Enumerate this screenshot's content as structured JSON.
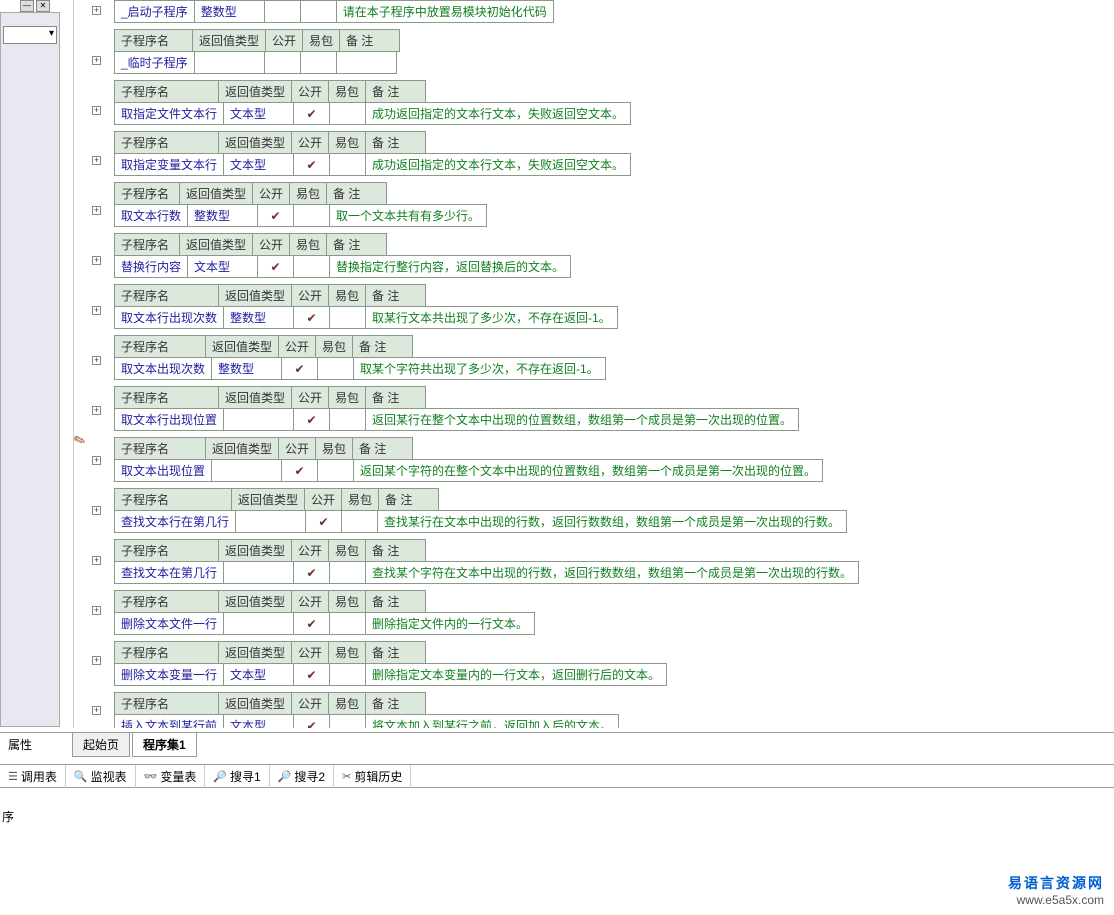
{
  "headers": {
    "name": "子程序名",
    "ret": "返回值类型",
    "pub": "公开",
    "pkg": "易包",
    "note": "备 注"
  },
  "subs": [
    {
      "name": "_启动子程序",
      "ret": "整数型",
      "pub": false,
      "pkg": "",
      "note": "请在本子程序中放置易模块初始化代码",
      "plusTop": 6,
      "headerOnly": false,
      "showHeader": false
    },
    {
      "name": "_临时子程序",
      "ret": "",
      "pub": false,
      "pkg": "",
      "note": "",
      "plusTop": 56,
      "showHeader": true
    },
    {
      "name": "取指定文件文本行",
      "ret": "文本型",
      "pub": true,
      "pkg": "",
      "note": "成功返回指定的文本行文本，失败返回空文本。",
      "plusTop": 106,
      "showHeader": true
    },
    {
      "name": "取指定变量文本行",
      "ret": "文本型",
      "pub": true,
      "pkg": "",
      "note": "成功返回指定的文本行文本，失败返回空文本。",
      "plusTop": 156,
      "showHeader": true
    },
    {
      "name": "取文本行数",
      "ret": "整数型",
      "pub": true,
      "pkg": "",
      "note": "取一个文本共有有多少行。",
      "plusTop": 206,
      "showHeader": true
    },
    {
      "name": "替换行内容",
      "ret": "文本型",
      "pub": true,
      "pkg": "",
      "note": "替换指定行整行内容，返回替换后的文本。",
      "plusTop": 256,
      "showHeader": true
    },
    {
      "name": "取文本行出现次数",
      "ret": "整数型",
      "pub": true,
      "pkg": "",
      "note": "取某行文本共出现了多少次，不存在返回-1。",
      "plusTop": 306,
      "showHeader": true
    },
    {
      "name": "取文本出现次数",
      "ret": "整数型",
      "pub": true,
      "pkg": "",
      "note": "取某个字符共出现了多少次，不存在返回-1。",
      "plusTop": 356,
      "showHeader": true
    },
    {
      "name": "取文本行出现位置",
      "ret": "",
      "pub": true,
      "pkg": "",
      "note": "返回某行在整个文本中出现的位置数组，数组第一个成员是第一次出现的位置。",
      "plusTop": 406,
      "showHeader": true
    },
    {
      "name": "取文本出现位置",
      "ret": "",
      "pub": true,
      "pkg": "",
      "note": "返回某个字符的在整个文本中出现的位置数组，数组第一个成员是第一次出现的位置。",
      "plusTop": 456,
      "showHeader": true
    },
    {
      "name": "查找文本行在第几行",
      "ret": "",
      "pub": true,
      "pkg": "",
      "note": "查找某行在文本中出现的行数，返回行数数组，数组第一个成员是第一次出现的行数。",
      "plusTop": 506,
      "showHeader": true
    },
    {
      "name": "查找文本在第几行",
      "ret": "",
      "pub": true,
      "pkg": "",
      "note": "查找某个字符在文本中出现的行数，返回行数数组，数组第一个成员是第一次出现的行数。",
      "plusTop": 556,
      "showHeader": true
    },
    {
      "name": "删除文本文件一行",
      "ret": "",
      "pub": true,
      "pkg": "",
      "note": "删除指定文件内的一行文本。",
      "plusTop": 606,
      "showHeader": true
    },
    {
      "name": "删除文本变量一行",
      "ret": "文本型",
      "pub": true,
      "pkg": "",
      "note": "删除指定文本变量内的一行文本，返回删行后的文本。",
      "plusTop": 656,
      "showHeader": true
    },
    {
      "name": "插入文本到某行前",
      "ret": "文本型",
      "pub": true,
      "pkg": "",
      "note": "将文本加入到某行之前，返回加入后的文本。",
      "plusTop": 706,
      "showHeader": true
    }
  ],
  "tabs1": {
    "prop": "属性",
    "start": "起始页",
    "set": "程序集1"
  },
  "tabs2": [
    {
      "icon": "☰",
      "label": "调用表"
    },
    {
      "icon": "🔍",
      "label": "监视表"
    },
    {
      "icon": "👓",
      "label": "变量表"
    },
    {
      "icon": "🔎",
      "label": "搜寻1"
    },
    {
      "icon": "🔎",
      "label": "搜寻2"
    },
    {
      "icon": "✂",
      "label": "剪辑历史"
    }
  ],
  "status": "序",
  "watermark": {
    "l1": "易语言资源网",
    "l2": "www.e5a5x.com"
  },
  "winbtns": {
    "min": "—",
    "close": "✕",
    "down": "▾"
  }
}
